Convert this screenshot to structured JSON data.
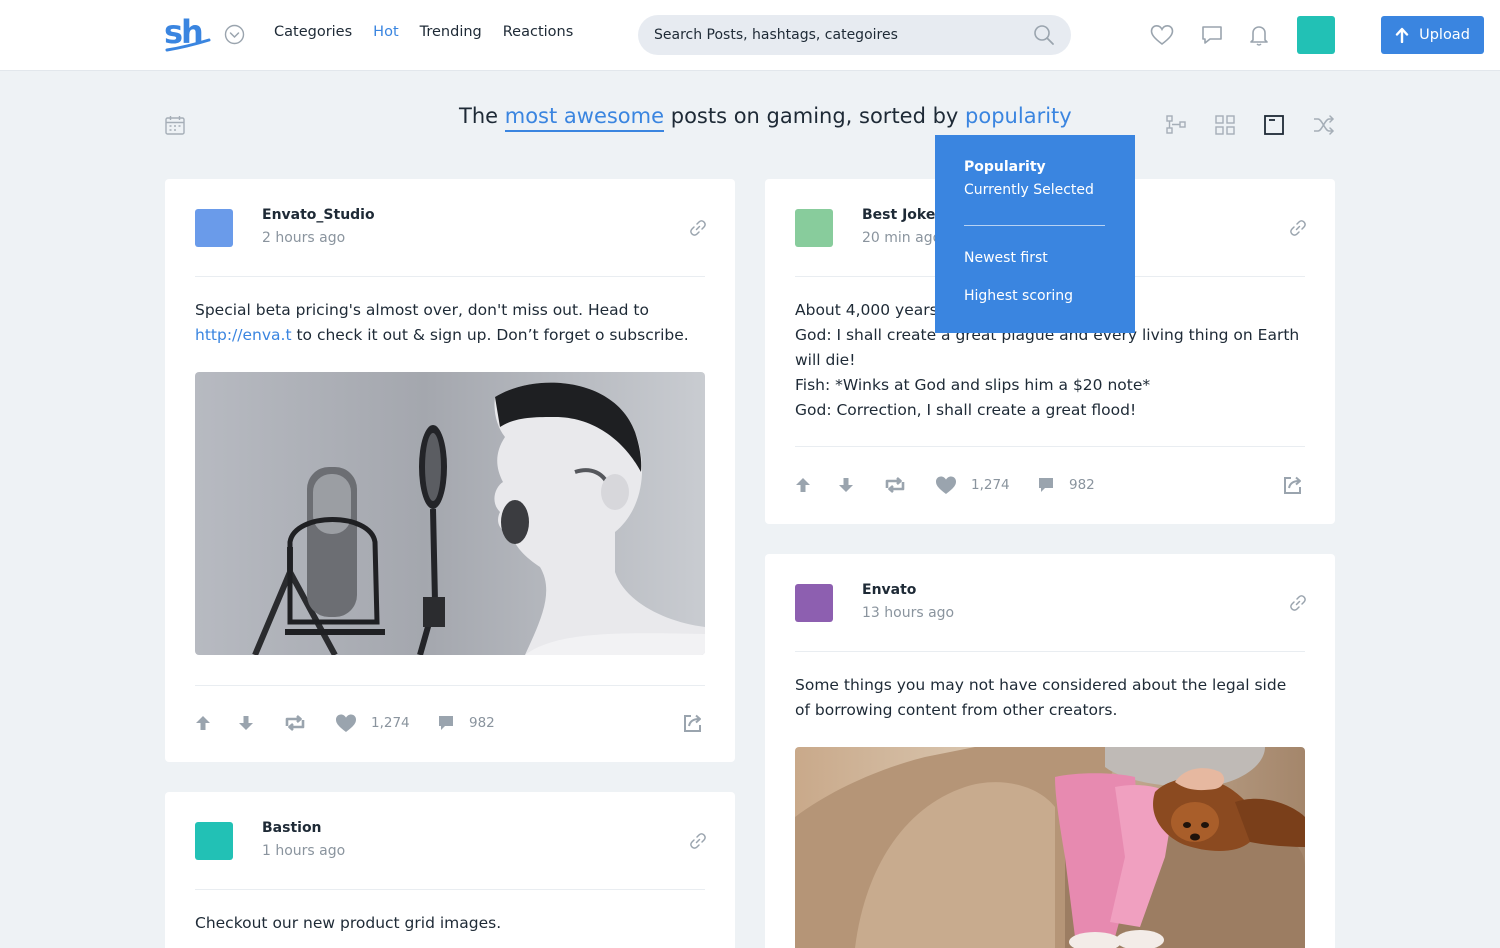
{
  "brand": {
    "logo_text": "sh"
  },
  "nav": [
    {
      "label": "Categories",
      "active": false
    },
    {
      "label": "Hot",
      "active": true
    },
    {
      "label": "Trending",
      "active": false
    },
    {
      "label": "Reactions",
      "active": false
    }
  ],
  "search": {
    "placeholder": "Search Posts, hashtags, categoires"
  },
  "header_icons": [
    "heart-icon",
    "chat-icon",
    "bell-icon"
  ],
  "upload": {
    "label": "Upload"
  },
  "headline": {
    "prefix": "The",
    "highlight1": "most awesome",
    "middle": "posts on gaming, sorted by",
    "highlight2": "popularity"
  },
  "view_icons": [
    "tree-view-icon",
    "grid-view-icon",
    "single-view-icon",
    "shuffle-icon"
  ],
  "sort_menu": {
    "selected_title": "Popularity",
    "selected_sub": "Currently Selected",
    "options": [
      "Newest first",
      "Highest scoring"
    ]
  },
  "colors": {
    "accent": "#3a85e0",
    "teal": "#22c1b5"
  },
  "posts": [
    {
      "author": "Envato_Studio",
      "time": "2 hours ago",
      "avatar_color": "#6a9bea",
      "text_before": "Special beta pricing's almost over, don't miss out. Head to ",
      "link": "http://enva.t",
      "text_after": "  to check it out & sign up. Don’t forget o subscribe.",
      "likes": "1,274",
      "comments": "982",
      "image": "boy-shouting-microphone"
    },
    {
      "author": "Best Jokes",
      "time": "20 min ago",
      "avatar_color": "#88cc9c",
      "lines": [
        "About 4,000 years",
        "God: I shall create a great plague and every living thing on Earth will die!",
        "Fish: *Winks at God and slips him a $20 note*",
        "God: Correction, I shall create a great flood!"
      ],
      "likes": "1,274",
      "comments": "982"
    },
    {
      "author": "Envato",
      "time": "13 hours ago",
      "avatar_color": "#8d5fb0",
      "text": "Some things you may not have considered about the legal side of borrowing content from other creators.",
      "image": "girl-with-puppy-on-sofa"
    },
    {
      "author": "Bastion",
      "time": "1 hours ago",
      "avatar_color": "#22c1b5",
      "text": "Checkout our new product grid images."
    }
  ]
}
